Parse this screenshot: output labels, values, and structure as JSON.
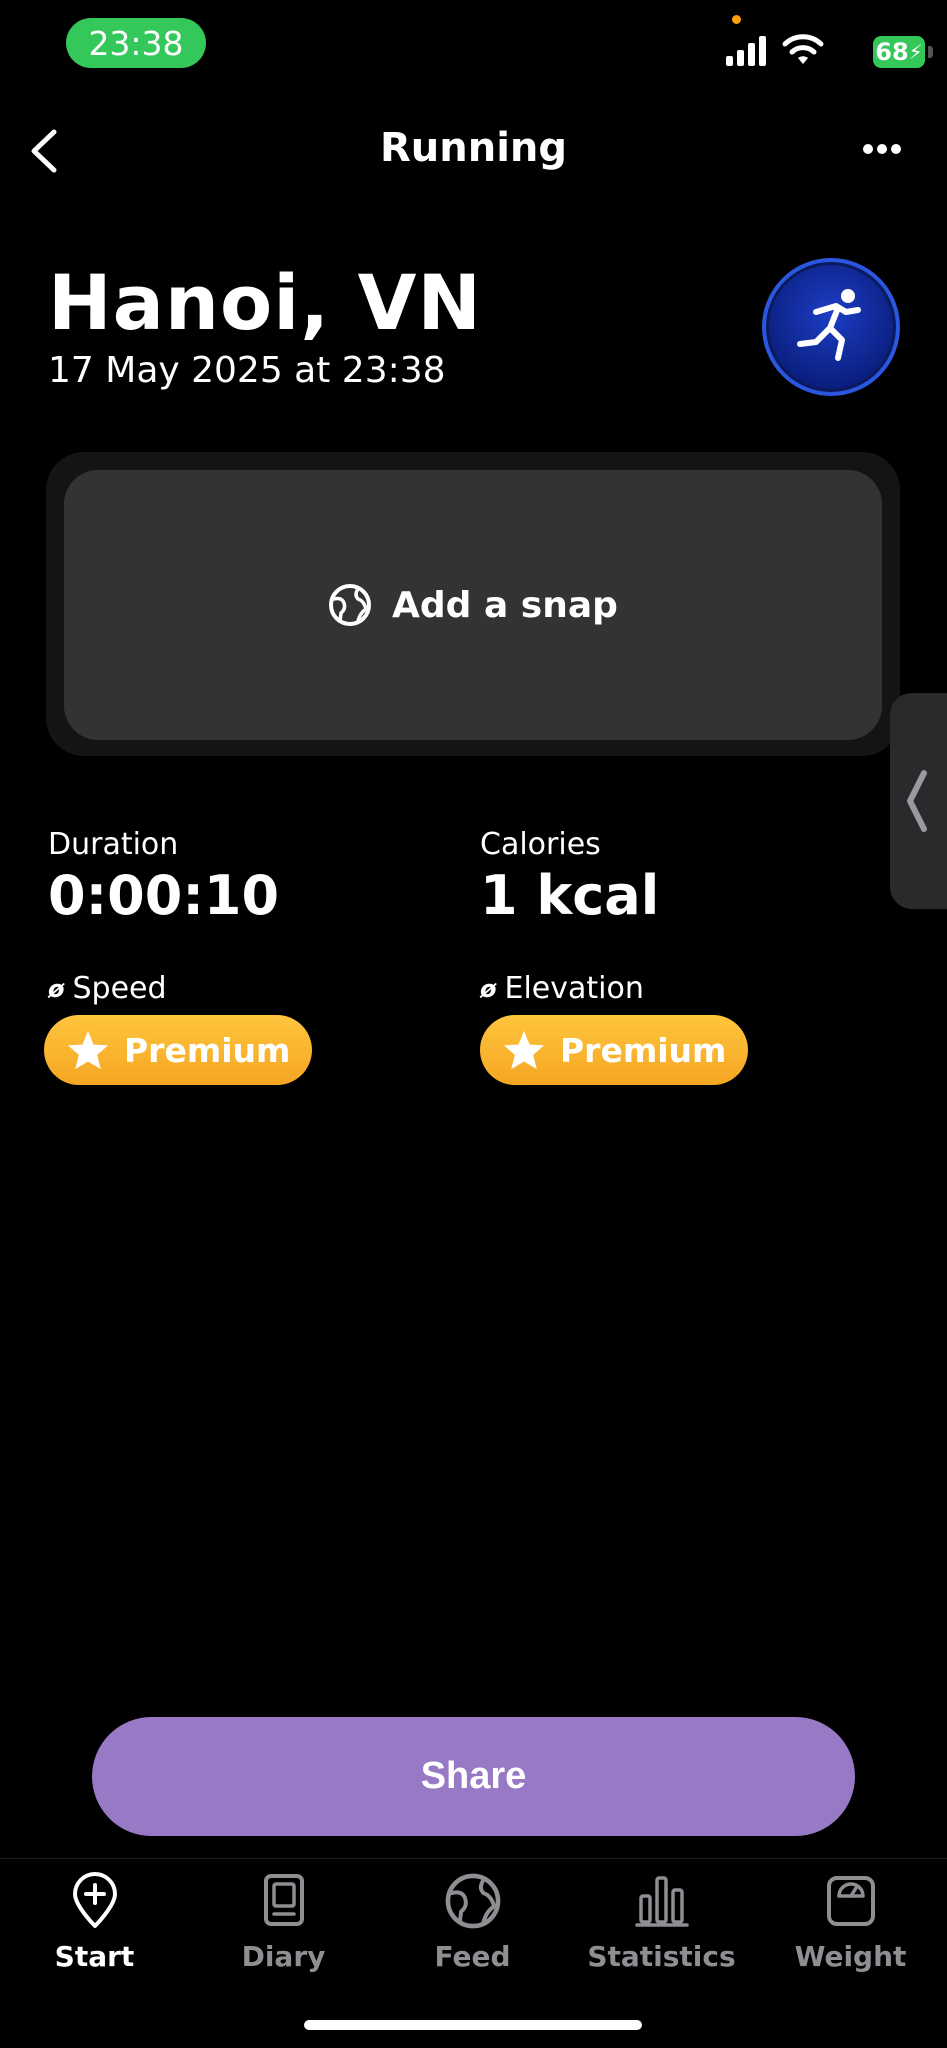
{
  "status_bar": {
    "time": "23:38",
    "battery": "68",
    "icons": [
      "cellular-signal-icon",
      "wifi-icon",
      "battery-charging-icon"
    ]
  },
  "header": {
    "title": "Running",
    "back_icon": "chevron-left-icon",
    "more_icon": "more-horizontal-icon"
  },
  "activity": {
    "location": "Hanoi, VN",
    "datetime": "17 May 2025 at 23:38",
    "badge_icon": "running-person-icon"
  },
  "snap": {
    "label": "Add a snap",
    "icon": "globe-icon"
  },
  "stats": {
    "duration": {
      "label": "Duration",
      "value": "0:00:10"
    },
    "calories": {
      "label": "Calories",
      "value": "1 kcal"
    },
    "speed": {
      "prefix": "ø",
      "label": "Speed",
      "badge": "Premium"
    },
    "elevation": {
      "prefix": "ø",
      "label": "Elevation",
      "badge": "Premium"
    }
  },
  "share_button": "Share",
  "tabs": [
    {
      "label": "Start",
      "icon": "location-plus-icon",
      "active": true
    },
    {
      "label": "Diary",
      "icon": "diary-icon",
      "active": false
    },
    {
      "label": "Feed",
      "icon": "globe-icon",
      "active": false
    },
    {
      "label": "Statistics",
      "icon": "bar-chart-icon",
      "active": false
    },
    {
      "label": "Weight",
      "icon": "scale-icon",
      "active": false
    }
  ],
  "colors": {
    "background": "#000000",
    "accent_share": "#9879c6",
    "premium": "#f5a623",
    "badge_blue": "#0a1f80",
    "time_pill": "#34c759"
  }
}
